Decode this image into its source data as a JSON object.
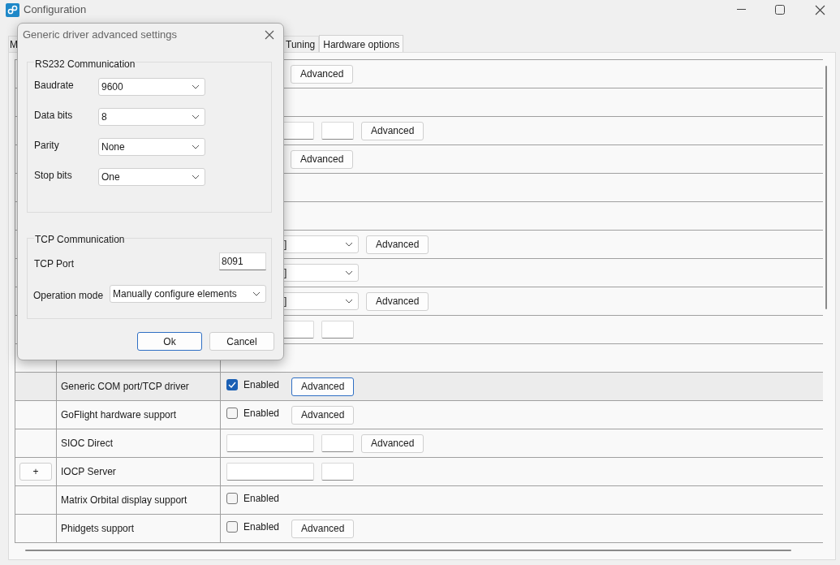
{
  "window": {
    "title": "Configuration"
  },
  "tabs": [
    {
      "label": "M",
      "selected": false
    },
    {
      "label": "Tuning",
      "selected": false
    },
    {
      "label": "Hardware options",
      "selected": true
    }
  ],
  "table": {
    "rows": [
      {
        "selected": false,
        "controls": [
          {
            "kind": "covered"
          },
          {
            "kind": "button",
            "label": "Advanced",
            "focused": false
          }
        ]
      },
      {
        "selected": false,
        "controls": []
      },
      {
        "selected": false,
        "controls": [
          {
            "kind": "wide_input"
          },
          {
            "kind": "narrow_input"
          },
          {
            "kind": "button",
            "label": "Advanced",
            "focused": false
          }
        ]
      },
      {
        "selected": false,
        "controls": [
          {
            "kind": "covered"
          },
          {
            "kind": "button",
            "label": "Advanced",
            "focused": false
          }
        ]
      },
      {
        "selected": false,
        "controls": []
      },
      {
        "selected": false,
        "controls": []
      },
      {
        "selected": false,
        "controls": [
          {
            "kind": "dropdown",
            "value": "]"
          },
          {
            "kind": "button",
            "label": "Advanced",
            "focused": false
          }
        ]
      },
      {
        "selected": false,
        "controls": [
          {
            "kind": "dropdown",
            "value": "]"
          }
        ]
      },
      {
        "selected": false,
        "controls": [
          {
            "kind": "dropdown",
            "value": "]"
          },
          {
            "kind": "button",
            "label": "Advanced",
            "focused": false
          }
        ]
      },
      {
        "selected": false,
        "controls": [
          {
            "kind": "wide_input"
          },
          {
            "kind": "narrow_input"
          }
        ]
      },
      {
        "selected": false,
        "controls": []
      },
      {
        "selected": true,
        "name": "Generic COM port/TCP driver",
        "controls": [
          {
            "kind": "checkbox",
            "label": "Enabled",
            "checked": true
          },
          {
            "kind": "button",
            "label": "Advanced",
            "focused": true
          }
        ]
      },
      {
        "selected": false,
        "name": "GoFlight hardware support",
        "controls": [
          {
            "kind": "checkbox",
            "label": "Enabled",
            "checked": false
          },
          {
            "kind": "button",
            "label": "Advanced",
            "focused": false
          }
        ]
      },
      {
        "selected": false,
        "name": "SIOC Direct",
        "controls": [
          {
            "kind": "wide_input"
          },
          {
            "kind": "narrow_input"
          },
          {
            "kind": "button",
            "label": "Advanced",
            "focused": false
          }
        ]
      },
      {
        "selected": false,
        "expand": "+",
        "name": "IOCP Server",
        "controls": [
          {
            "kind": "wide_input"
          },
          {
            "kind": "narrow_input"
          }
        ]
      },
      {
        "selected": false,
        "name": "Matrix Orbital display support",
        "controls": [
          {
            "kind": "checkbox",
            "label": "Enabled",
            "checked": false
          }
        ]
      },
      {
        "selected": false,
        "name": "Phidgets support",
        "controls": [
          {
            "kind": "checkbox",
            "label": "Enabled",
            "checked": false
          },
          {
            "kind": "button",
            "label": "Advanced",
            "focused": false
          }
        ]
      }
    ]
  },
  "dialog": {
    "title": "Generic driver advanced settings",
    "rs232": {
      "title": "RS232 Communication",
      "fields": [
        {
          "label": "Baudrate",
          "value": "9600"
        },
        {
          "label": "Data bits",
          "value": "8"
        },
        {
          "label": "Parity",
          "value": "None"
        },
        {
          "label": "Stop bits",
          "value": "One"
        }
      ]
    },
    "tcp": {
      "title": "TCP Communication",
      "port_label": "TCP Port",
      "port": "8091",
      "mode_label": "Operation mode",
      "mode": "Manually configure elements"
    },
    "buttons": [
      {
        "label": "Ok",
        "focused": true
      },
      {
        "label": "Cancel",
        "focused": false
      }
    ]
  }
}
